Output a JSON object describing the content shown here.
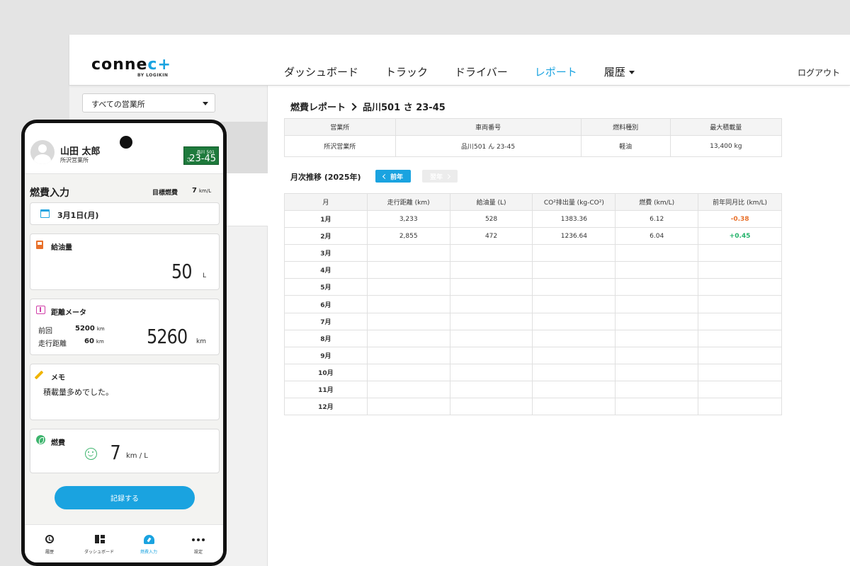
{
  "app": {
    "logo_text": "conne",
    "logo_plus": "c+",
    "logo_sub": "BY LOGIKIN"
  },
  "nav": {
    "items": [
      {
        "label": "ダッシュボード",
        "active": false
      },
      {
        "label": "トラック",
        "active": false
      },
      {
        "label": "ドライバー",
        "active": false
      },
      {
        "label": "レポート",
        "active": true
      },
      {
        "label": "履歴",
        "active": false,
        "has_dropdown": true
      }
    ],
    "logout": "ログアウト"
  },
  "sidebar": {
    "office_select": "すべての営業所"
  },
  "report": {
    "breadcrumb_root": "燃費レポート",
    "breadcrumb_current": "品川501 さ 23-45",
    "info_headers": [
      "営業所",
      "車両番号",
      "燃料種別",
      "最大積載量"
    ],
    "info_values": [
      "所沢営業所",
      "品川501 ん 23-45",
      "軽油",
      "13,400 kg"
    ],
    "monthly_title": "月次推移 (2025年)",
    "prev_label": "前年",
    "next_label": "翌年",
    "table_headers": [
      "月",
      "走行距離 (km)",
      "給油量 (L)",
      "CO²排出量 (kg-CO²)",
      "燃費 (km/L)",
      "前年同月比 (km/L)"
    ],
    "rows": [
      {
        "month": "1月",
        "distance": "3,233",
        "fuel": "528",
        "co2": "1383.36",
        "efficiency": "6.12",
        "yoy": "-0.38",
        "yoy_sign": "neg"
      },
      {
        "month": "2月",
        "distance": "2,855",
        "fuel": "472",
        "co2": "1236.64",
        "efficiency": "6.04",
        "yoy": "+0.45",
        "yoy_sign": "pos"
      },
      {
        "month": "3月",
        "distance": "",
        "fuel": "",
        "co2": "",
        "efficiency": "",
        "yoy": "",
        "yoy_sign": ""
      },
      {
        "month": "4月",
        "distance": "",
        "fuel": "",
        "co2": "",
        "efficiency": "",
        "yoy": "",
        "yoy_sign": ""
      },
      {
        "month": "5月",
        "distance": "",
        "fuel": "",
        "co2": "",
        "efficiency": "",
        "yoy": "",
        "yoy_sign": ""
      },
      {
        "month": "6月",
        "distance": "",
        "fuel": "",
        "co2": "",
        "efficiency": "",
        "yoy": "",
        "yoy_sign": ""
      },
      {
        "month": "7月",
        "distance": "",
        "fuel": "",
        "co2": "",
        "efficiency": "",
        "yoy": "",
        "yoy_sign": ""
      },
      {
        "month": "8月",
        "distance": "",
        "fuel": "",
        "co2": "",
        "efficiency": "",
        "yoy": "",
        "yoy_sign": ""
      },
      {
        "month": "9月",
        "distance": "",
        "fuel": "",
        "co2": "",
        "efficiency": "",
        "yoy": "",
        "yoy_sign": ""
      },
      {
        "month": "10月",
        "distance": "",
        "fuel": "",
        "co2": "",
        "efficiency": "",
        "yoy": "",
        "yoy_sign": ""
      },
      {
        "month": "11月",
        "distance": "",
        "fuel": "",
        "co2": "",
        "efficiency": "",
        "yoy": "",
        "yoy_sign": ""
      },
      {
        "month": "12月",
        "distance": "",
        "fuel": "",
        "co2": "",
        "efficiency": "",
        "yoy": "",
        "yoy_sign": ""
      }
    ]
  },
  "phone": {
    "user_name": "山田 太郎",
    "user_office": "所沢営業所",
    "plate_top": "品川 501",
    "plate_kana": "さ",
    "plate_number": "23-45",
    "screen_title": "燃費入力",
    "target_label": "目標燃費",
    "target_value": "7",
    "target_unit": "km/L",
    "date": "3月1日(月)",
    "fuel_label": "給油量",
    "fuel_value": "50",
    "fuel_unit": "L",
    "meter_label": "距離メータ",
    "prev_label": "前回",
    "prev_value": "5200",
    "prev_unit": "km",
    "trip_label": "走行距離",
    "trip_value": "60",
    "trip_unit": "km",
    "meter_value": "5260",
    "meter_unit": "km",
    "memo_label": "メモ",
    "memo_text": "積載量多めでした。",
    "eco_label": "燃費",
    "eco_value": "7",
    "eco_unit": "km / L",
    "record_button": "記録する",
    "tabs": [
      {
        "label": "履歴",
        "active": false
      },
      {
        "label": "ダッシュボード",
        "active": false
      },
      {
        "label": "燃費入力",
        "active": true
      },
      {
        "label": "設定",
        "active": false
      }
    ]
  },
  "colors": {
    "accent": "#1aa3e0",
    "negative": "#e8702a",
    "positive": "#24b36b",
    "plate_green": "#1e7a3c"
  }
}
